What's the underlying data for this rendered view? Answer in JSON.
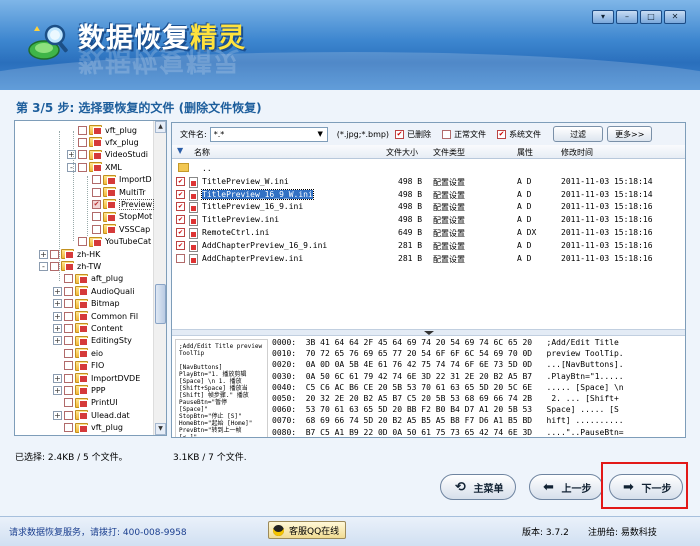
{
  "app": {
    "title_a": "数据恢复",
    "title_b": "精灵",
    "window_buttons": [
      "▾",
      "–",
      "□",
      "✕"
    ]
  },
  "step_title": "第 3/5 步: 选择要恢复的文件 (删除文件恢复)",
  "tree": [
    {
      "label": "vft_plug",
      "indent": 2,
      "expander": ""
    },
    {
      "label": "vfx_plug",
      "indent": 2,
      "expander": ""
    },
    {
      "label": "VideoStudi",
      "indent": 2,
      "expander": "+"
    },
    {
      "label": "XML",
      "indent": 2,
      "expander": "-"
    },
    {
      "label": "ImportD",
      "indent": 3,
      "expander": ""
    },
    {
      "label": "MultiTr",
      "indent": 3,
      "expander": ""
    },
    {
      "label": "Preview",
      "indent": 3,
      "expander": "",
      "selected": true
    },
    {
      "label": "StopMot",
      "indent": 3,
      "expander": ""
    },
    {
      "label": "VSSCap",
      "indent": 3,
      "expander": ""
    },
    {
      "label": "YouTubeCat",
      "indent": 2,
      "expander": ""
    },
    {
      "label": "zh-HK",
      "indent": 0,
      "expander": "+"
    },
    {
      "label": "zh-TW",
      "indent": 0,
      "expander": "-"
    },
    {
      "label": "aft_plug",
      "indent": 1,
      "expander": ""
    },
    {
      "label": "AudioQuali",
      "indent": 1,
      "expander": "+"
    },
    {
      "label": "Bitmap",
      "indent": 1,
      "expander": "+"
    },
    {
      "label": "Common Fil",
      "indent": 1,
      "expander": "+"
    },
    {
      "label": "Content",
      "indent": 1,
      "expander": "+"
    },
    {
      "label": "EditingSty",
      "indent": 1,
      "expander": "+"
    },
    {
      "label": "eio",
      "indent": 1,
      "expander": ""
    },
    {
      "label": "FIO",
      "indent": 1,
      "expander": ""
    },
    {
      "label": "ImportDVDE",
      "indent": 1,
      "expander": "+"
    },
    {
      "label": "PPP",
      "indent": 1,
      "expander": "+"
    },
    {
      "label": "PrintUI",
      "indent": 1,
      "expander": ""
    },
    {
      "label": "Ulead.dat",
      "indent": 1,
      "expander": "+"
    },
    {
      "label": "vft_plug",
      "indent": 1,
      "expander": ""
    }
  ],
  "filter": {
    "name_label": "文件名:",
    "name_value": "*.*",
    "ext_hint": "(*.jpg;*.bmp)",
    "deleted_label": "已删除",
    "normal_label": "正常文件",
    "system_label": "系统文件",
    "filter_button": "过滤",
    "more_button": "更多>>"
  },
  "columns": {
    "name": "名称",
    "size": "文件大小",
    "type": "文件类型",
    "attr": "属性",
    "mtime": "修改时间"
  },
  "files": [
    {
      "name": "..",
      "size": "",
      "type": "",
      "attr": "",
      "mtime": "",
      "checked": false,
      "parent": true
    },
    {
      "name": "TitlePreview_W.ini",
      "size": "498 B",
      "type": "配置设置",
      "attr": "A D",
      "mtime": "2011-11-03 15:18:14",
      "checked": true
    },
    {
      "name": "TitlePreview_16_9_W.ini",
      "size": "498 B",
      "type": "配置设置",
      "attr": "A D",
      "mtime": "2011-11-03 15:18:14",
      "checked": true,
      "selected": true
    },
    {
      "name": "TitlePreview_16_9.ini",
      "size": "498 B",
      "type": "配置设置",
      "attr": "A D",
      "mtime": "2011-11-03 15:18:16",
      "checked": true
    },
    {
      "name": "TitlePreview.ini",
      "size": "498 B",
      "type": "配置设置",
      "attr": "A D",
      "mtime": "2011-11-03 15:18:16",
      "checked": true
    },
    {
      "name": "RemoteCtrl.ini",
      "size": "649 B",
      "type": "配置设置",
      "attr": "A DX",
      "mtime": "2011-11-03 15:18:16",
      "checked": true
    },
    {
      "name": "AddChapterPreview_16_9.ini",
      "size": "281 B",
      "type": "配置设置",
      "attr": "A D",
      "mtime": "2011-11-03 15:18:16",
      "checked": true
    },
    {
      "name": "AddChapterPreview.ini",
      "size": "281 B",
      "type": "配置设置",
      "attr": "A D",
      "mtime": "2011-11-03 15:18:16",
      "checked": false
    }
  ],
  "preview_text": ";Add/Edit Title preview ToolTip\n\n[NavButtons]\nPlayBtn=\"1. 播放剪辑\n[Space] \\n 1. 播放\n[Shift+Space] 播放当\n[Shift] 帧步骤.\" 播放\nPauseBtn=\"暂停\n[Space]\"\nStopBtn=\"停止 [S]\"\nHomeBtn=\"起始 [Home]\"\nPrevBtn=\"转到上一帧\n[<-]\"",
  "hex_lines": [
    "0000:  3B 41 64 64 2F 45 64 69 74 20 54 69 74 6C 65 20   ;Add/Edit Title",
    "0010:  70 72 65 76 69 65 77 20 54 6F 6F 6C 54 69 70 0D   preview ToolTip.",
    "0020:  0A 0D 0A 5B 4E 61 76 42 75 74 74 6F 6E 73 5D 0D   ...[NavButtons].",
    "0030:  0A 50 6C 61 79 42 74 6E 3D 22 31 2E 20 B2 A5 B7   .PlayBtn=\"1.....",
    "0040:  C5 C6 AC B6 CE 20 5B 53 70 61 63 65 5D 20 5C 6E   ..... [Space] \\n",
    "0050:  20 32 2E 20 B2 A5 B7 C5 20 5B 53 68 69 66 74 2B    2. ... [Shift+",
    "0060:  53 70 61 63 65 5D 20 BB F2 B0 B4 D7 A1 20 5B 53   Space] ..... [S",
    "0070:  68 69 66 74 5D 20 B2 A5 B5 A5 B8 F7 D6 A1 B5 BD   hift] ..........",
    "0080:  B7 C5 A1 B9 22 0D 0A 50 61 75 73 65 42 74 6E 3D   ....\"..PauseBtn="
  ],
  "status": {
    "left": "已选择: 2.4KB / 5 个文件。",
    "right": "3.1KB / 7 个文件."
  },
  "buttons": {
    "main_menu": "主菜单",
    "prev": "上一步",
    "next": "下一步"
  },
  "footer": {
    "service": "请求数据恢复服务，请拨打: 400-008-9958",
    "qq": "客服QQ在线",
    "version": "版本: 3.7.2",
    "registered": "注册给: 易数科技"
  }
}
